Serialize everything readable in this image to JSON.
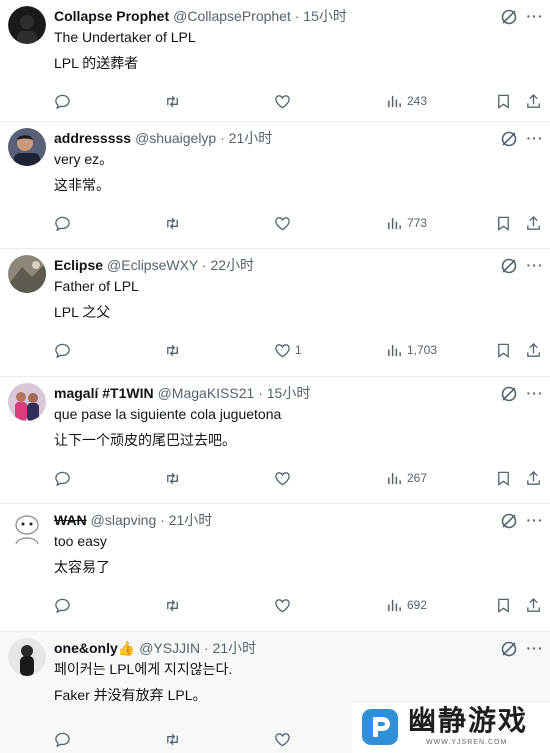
{
  "tweets": [
    {
      "name": "Collapse Prophet",
      "handle": "@CollapseProphet · 15小时",
      "line1": "The Undertaker of LPL",
      "line2": "LPL 的送葬者",
      "likes": "",
      "views": "243",
      "avatar_color": "#1a1a1a"
    },
    {
      "name": "addresssss",
      "handle": "@shuaigelyp · 21小时",
      "line1": "very ez。",
      "line2": "这非常。",
      "likes": "",
      "views": "773",
      "avatar_color": "#3a3f55"
    },
    {
      "name": "Eclipse",
      "handle": "@EclipseWXY · 22小时",
      "line1": "Father of LPL",
      "line2": "LPL 之父",
      "likes": "1",
      "views": "1,703",
      "avatar_color": "#7a7468"
    },
    {
      "name": "magalí #T1WIN",
      "handle": "@MagaKISS21 · 15小时",
      "line1": "que pase la siguiente cola juguetona",
      "line2": "让下一个顽皮的尾巴过去吧。",
      "likes": "",
      "views": "267",
      "avatar_color": "#c84a7a"
    },
    {
      "name": "WAN",
      "handle": "@slapving · 21小时",
      "line1": "too easy",
      "line2": "太容易了",
      "likes": "",
      "views": "692",
      "avatar_color": "#e8eef2"
    },
    {
      "name": "one&only👍",
      "handle": "@YSJJIN · 21小时",
      "line1": "페이커는 LPL에게 지지않는다.",
      "line2": "Faker 并没有放弃 LPL。",
      "likes": "",
      "views": "",
      "avatar_color": "#2a2a2a"
    }
  ],
  "watermark": {
    "text": "幽静游戏",
    "url": "WWW.YJSREN.COM",
    "color": "#2f8fd8"
  }
}
